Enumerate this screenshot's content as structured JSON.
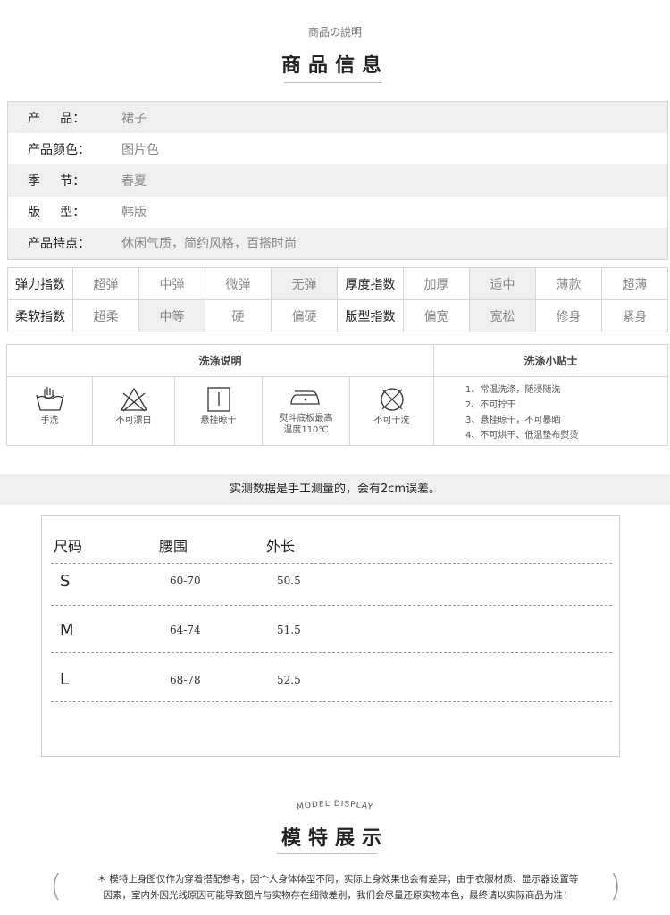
{
  "product_section": {
    "subtitle": "商品の說明",
    "title": "商品信息",
    "rows": [
      {
        "label": "产     品：",
        "value": "裙子"
      },
      {
        "label": "产品颜色：",
        "value": "图片色"
      },
      {
        "label": "季     节：",
        "value": "春夏"
      },
      {
        "label": "版     型：",
        "value": "韩版"
      },
      {
        "label": "产品特点：",
        "value": "休闲气质，简约风格，百搭时尚"
      }
    ]
  },
  "indices": {
    "elastic": {
      "label": "弹力指数",
      "options": [
        "超弹",
        "中弹",
        "微弹",
        "无弹"
      ],
      "selected": "无弹"
    },
    "thickness": {
      "label": "厚度指数",
      "options": [
        "加厚",
        "适中",
        "薄款",
        "超薄"
      ],
      "selected": "适中"
    },
    "softness": {
      "label": "柔软指数",
      "options": [
        "超柔",
        "中等",
        "硬",
        "偏硬"
      ],
      "selected": "中等"
    },
    "fit": {
      "label": "版型指数",
      "options": [
        "偏宽",
        "宽松",
        "修身",
        "紧身"
      ],
      "selected": "宽松"
    }
  },
  "wash": {
    "title": "洗涤说明",
    "icons": [
      {
        "icon": "hand-wash-icon",
        "caption": "手洗"
      },
      {
        "icon": "no-bleach-icon",
        "caption": "不可漂白"
      },
      {
        "icon": "hang-dry-icon",
        "caption": "悬挂晾干"
      },
      {
        "icon": "iron-icon",
        "caption": "熨斗底板最高",
        "caption2": "温度110℃"
      },
      {
        "icon": "no-dry-clean-icon",
        "caption": "不可干洗"
      }
    ],
    "tips_title": "洗涤小贴士",
    "tips": [
      "1、常温洗涤，随浸随洗",
      "2、不可拧干",
      "3、悬挂晾干，不可暴晒",
      "4、不可烘干、低温垫布熨烫"
    ]
  },
  "notice": "实测数据是手工测量的，会有2cm误差。",
  "size_table": {
    "headers": [
      "尺码",
      "腰围",
      "外长"
    ],
    "rows": [
      {
        "size": "S",
        "waist": "60-70",
        "length": "50.5"
      },
      {
        "size": "M",
        "waist": "64-74",
        "length": "51.5"
      },
      {
        "size": "L",
        "waist": "68-78",
        "length": "52.5"
      }
    ]
  },
  "model_section": {
    "subtitle": "MODEL DISPLAY",
    "title": "模特展示",
    "disclaimer_line1": "＊ 模特上身图仅作为穿着搭配参考，因个人身体体型不同，实际上身效果也会有差异；由于衣服材质、显示器设置等",
    "disclaimer_line2": "因素，室内外因光线原因可能导致图片与实物存在细微差别，我们会尽量还原实物本色，最终请以实际商品为准！",
    "bracket_left": "(",
    "bracket_right": ")"
  },
  "colors": {
    "highlight": "#efefef",
    "border": "#d6d6d6"
  }
}
